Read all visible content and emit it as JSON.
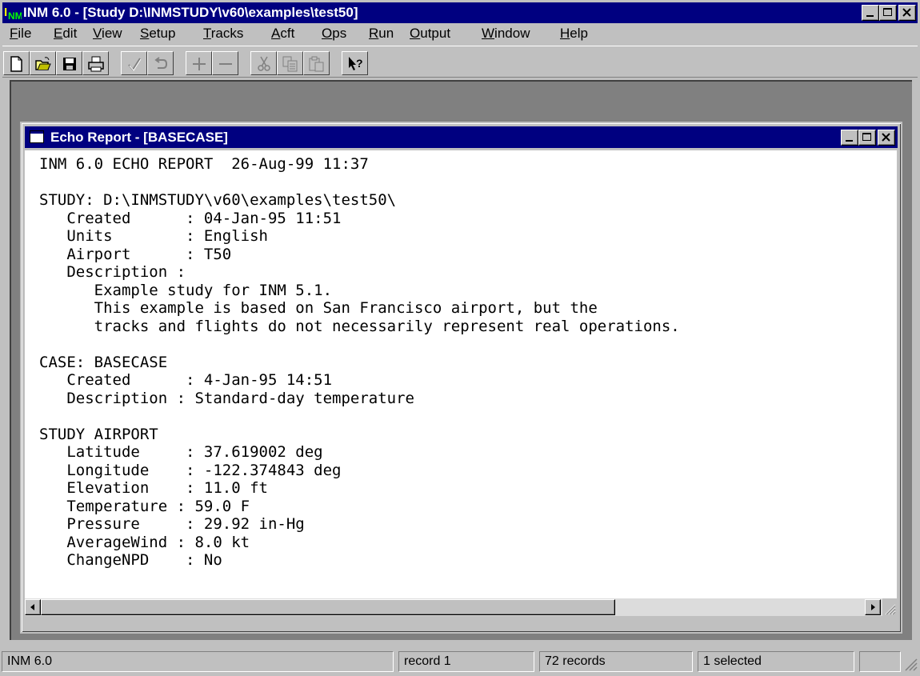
{
  "window": {
    "title": "INM 6.0 - [Study D:\\INMSTUDY\\v60\\examples\\test50]",
    "logo_text": "NM",
    "controls": [
      "minimize",
      "maximize",
      "close"
    ]
  },
  "menu": {
    "items": [
      {
        "label": "File",
        "accel": "F",
        "rest": "ile"
      },
      {
        "label": "Edit",
        "accel": "E",
        "rest": "dit"
      },
      {
        "label": "View",
        "accel": "V",
        "rest": "iew"
      },
      {
        "label": "Setup",
        "accel": "S",
        "rest": "etup"
      },
      {
        "label": "Tracks",
        "accel": "T",
        "rest": "racks"
      },
      {
        "label": "Acft",
        "accel": "A",
        "rest": "cft"
      },
      {
        "label": "Ops",
        "accel": "O",
        "rest": "ps"
      },
      {
        "label": "Run",
        "accel": "R",
        "rest": "un"
      },
      {
        "label": "Output",
        "accel": "O",
        "rest": "utput"
      },
      {
        "label": "Window",
        "accel": "W",
        "rest": "indow"
      },
      {
        "label": "Help",
        "accel": "H",
        "rest": "elp"
      }
    ]
  },
  "toolbar": {
    "buttons": [
      "new-icon",
      "open-icon",
      "save-icon",
      "print-icon",
      "commit-check-icon",
      "undo-icon",
      "add-plus-icon",
      "delete-minus-icon",
      "cut-icon",
      "copy-icon",
      "paste-icon",
      "context-help-icon"
    ]
  },
  "child_window": {
    "title": "Echo Report - [BASECASE]",
    "report_lines": [
      "INM 6.0 ECHO REPORT  26-Aug-99 11:37",
      "",
      "STUDY: D:\\INMSTUDY\\v60\\examples\\test50\\",
      "   Created      : 04-Jan-95 11:51",
      "   Units        : English",
      "   Airport      : T50",
      "   Description :",
      "      Example study for INM 5.1.",
      "      This example is based on San Francisco airport, but the",
      "      tracks and flights do not necessarily represent real operations.",
      "",
      "CASE: BASECASE",
      "   Created      : 4-Jan-95 14:51",
      "   Description : Standard-day temperature",
      "",
      "STUDY AIRPORT",
      "   Latitude     : 37.619002 deg",
      "   Longitude    : -122.374843 deg",
      "   Elevation    : 11.0 ft",
      "   Temperature : 59.0 F",
      "   Pressure     : 29.92 in-Hg",
      "   AverageWind : 8.0 kt",
      "   ChangeNPD    : No"
    ]
  },
  "statusbar": {
    "app": "INM 6.0",
    "record": "record 1",
    "records": "72 records",
    "selected": "1 selected",
    "extra": ""
  },
  "colors": {
    "title_bar": "#000080",
    "face": "#c0c0c0",
    "mdi_background": "#808080",
    "logo_yellow": "#ffff00",
    "logo_green": "#00ff00"
  }
}
